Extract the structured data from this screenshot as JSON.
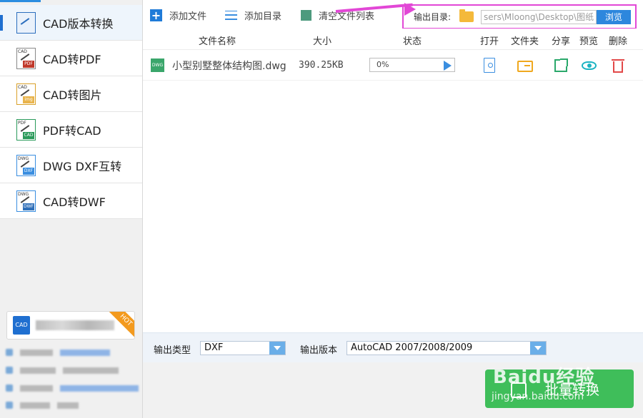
{
  "sidebar": {
    "items": [
      {
        "label": "CAD版本转换",
        "icon": "cad-version-icon",
        "tag": "",
        "mark": ""
      },
      {
        "label": "CAD转PDF",
        "icon": "cad-to-pdf-icon",
        "tag": "CAD",
        "mark": "PDF"
      },
      {
        "label": "CAD转图片",
        "icon": "cad-to-image-icon",
        "tag": "CAD",
        "mark": "img"
      },
      {
        "label": "PDF转CAD",
        "icon": "pdf-to-cad-icon",
        "tag": "PDF",
        "mark": "CAD"
      },
      {
        "label": "DWG DXF互转",
        "icon": "dwg-dxf-icon",
        "tag": "DWG",
        "mark": "DXF"
      },
      {
        "label": "CAD转DWF",
        "icon": "cad-to-dwf-icon",
        "tag": "DWG",
        "mark": "DWF"
      }
    ],
    "promo": {
      "icon_text": "CAD",
      "hot": "HOT"
    }
  },
  "toolbar": {
    "add_file": "添加文件",
    "add_dir": "添加目录",
    "clear_list": "清空文件列表",
    "output_label": "输出目录:",
    "output_path": "sers\\Mloong\\Desktop\\图纸",
    "browse": "浏览"
  },
  "table": {
    "headers": {
      "name": "文件名称",
      "size": "大小",
      "status": "状态",
      "open": "打开",
      "folder": "文件夹",
      "share": "分享",
      "preview": "预览",
      "delete": "删除"
    },
    "rows": [
      {
        "icon_text": "DWG",
        "name": "小型别墅整体结构图.dwg",
        "size": "390.25KB",
        "progress_text": "0%",
        "progress": 0
      }
    ]
  },
  "options": {
    "type_label": "输出类型",
    "type_value": "DXF",
    "version_label": "输出版本",
    "version_value": "AutoCAD 2007/2008/2009"
  },
  "convert_button": "批量转换",
  "watermark": {
    "main": "Baidu经验",
    "sub": "jingyan.baidu.com"
  },
  "colors": {
    "accent": "#2d87dd",
    "highlight": "#e247d6",
    "convert": "#3fbe5a"
  }
}
